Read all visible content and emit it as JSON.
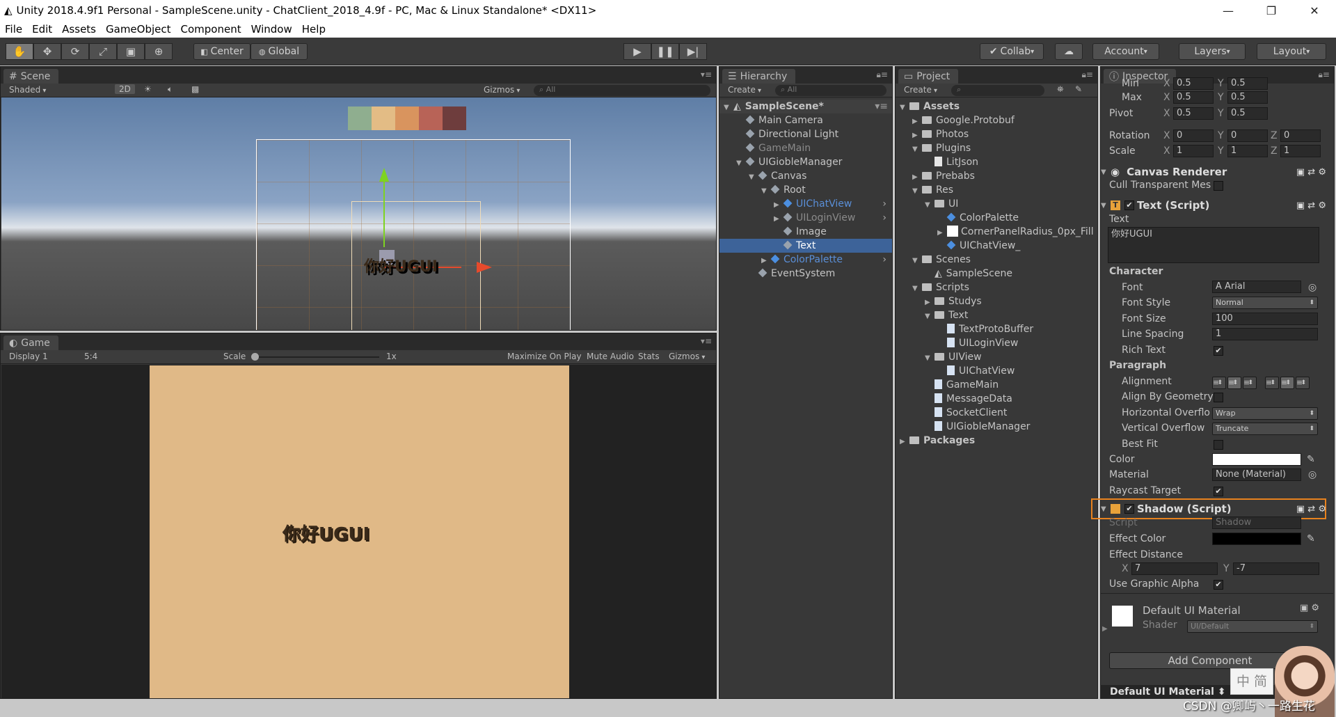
{
  "window": {
    "title": "Unity 2018.4.9f1 Personal - SampleScene.unity - ChatClient_2018_4.9f - PC, Mac & Linux Standalone* <DX11>",
    "minimize": "—",
    "restore": "❐",
    "close": "✕"
  },
  "menu": [
    "File",
    "Edit",
    "Assets",
    "GameObject",
    "Component",
    "Window",
    "Help"
  ],
  "toolbar": {
    "pivot": "Center",
    "space": "Global",
    "collab": "Collab",
    "account": "Account",
    "layers": "Layers",
    "layout": "Layout"
  },
  "scene": {
    "tab": "Scene",
    "shading": "Shaded",
    "mode2d": "2D",
    "gizmos": "Gizmos",
    "search": "All",
    "text": "你好UGUI",
    "palette": [
      "#8fae8f",
      "#e3bc85",
      "#d9945e",
      "#b86357",
      "#6e3d3d"
    ],
    "bg": "#e0b987"
  },
  "game": {
    "tab": "Game",
    "display": "Display 1",
    "aspect": "5:4",
    "scale_label": "Scale",
    "scale_value": "1x",
    "maximize": "Maximize On Play",
    "mute": "Mute Audio",
    "stats": "Stats",
    "gizmos": "Gizmos",
    "text": "你好UGUI"
  },
  "hierarchy": {
    "tab": "Hierarchy",
    "create": "Create",
    "search": "All",
    "scene": "SampleScene*",
    "items": [
      {
        "label": "Main Camera",
        "depth": 1,
        "arrow": "",
        "style": ""
      },
      {
        "label": "Directional Light",
        "depth": 1,
        "arrow": "",
        "style": ""
      },
      {
        "label": "GameMain",
        "depth": 1,
        "arrow": "",
        "style": "dim"
      },
      {
        "label": "UIGiobleManager",
        "depth": 1,
        "arrow": "▼",
        "style": ""
      },
      {
        "label": "Canvas",
        "depth": 2,
        "arrow": "▼",
        "style": ""
      },
      {
        "label": "Root",
        "depth": 3,
        "arrow": "▼",
        "style": ""
      },
      {
        "label": "UIChatView",
        "depth": 4,
        "arrow": "▶",
        "style": "blue dim",
        "more": true
      },
      {
        "label": "UILoginView",
        "depth": 4,
        "arrow": "▶",
        "style": "dim",
        "more": true
      },
      {
        "label": "Image",
        "depth": 4,
        "arrow": "",
        "style": ""
      },
      {
        "label": "Text",
        "depth": 4,
        "arrow": "",
        "style": "sel"
      },
      {
        "label": "ColorPalette",
        "depth": 3,
        "arrow": "▶",
        "style": "blue",
        "more": true
      },
      {
        "label": "EventSystem",
        "depth": 2,
        "arrow": "",
        "style": ""
      }
    ]
  },
  "project": {
    "tab": "Project",
    "create": "Create",
    "items": [
      {
        "label": "Assets",
        "depth": 0,
        "arrow": "▼",
        "icon": "folder",
        "bold": true
      },
      {
        "label": "Google.Protobuf",
        "depth": 1,
        "arrow": "▶",
        "icon": "folder"
      },
      {
        "label": "Photos",
        "depth": 1,
        "arrow": "▶",
        "icon": "folder"
      },
      {
        "label": "Plugins",
        "depth": 1,
        "arrow": "▼",
        "icon": "folder"
      },
      {
        "label": "LitJson",
        "depth": 2,
        "arrow": "",
        "icon": "file"
      },
      {
        "label": "Prebabs",
        "depth": 1,
        "arrow": "▶",
        "icon": "folder"
      },
      {
        "label": "Res",
        "depth": 1,
        "arrow": "▼",
        "icon": "folder"
      },
      {
        "label": "UI",
        "depth": 2,
        "arrow": "▼",
        "icon": "folder"
      },
      {
        "label": "ColorPalette",
        "depth": 3,
        "arrow": "",
        "icon": "prefab"
      },
      {
        "label": "CornerPanelRadius_0px_Fill",
        "depth": 3,
        "arrow": "▶",
        "icon": "white"
      },
      {
        "label": "UIChatView_",
        "depth": 3,
        "arrow": "",
        "icon": "prefab"
      },
      {
        "label": "Scenes",
        "depth": 1,
        "arrow": "▼",
        "icon": "folder"
      },
      {
        "label": "SampleScene",
        "depth": 2,
        "arrow": "",
        "icon": "unity"
      },
      {
        "label": "Scripts",
        "depth": 1,
        "arrow": "▼",
        "icon": "folder"
      },
      {
        "label": "Studys",
        "depth": 2,
        "arrow": "▶",
        "icon": "folder"
      },
      {
        "label": "Text",
        "depth": 2,
        "arrow": "▼",
        "icon": "folder"
      },
      {
        "label": "TextProtoBuffer",
        "depth": 3,
        "arrow": "",
        "icon": "cs"
      },
      {
        "label": "UILoginView",
        "depth": 3,
        "arrow": "",
        "icon": "cs"
      },
      {
        "label": "UIView",
        "depth": 2,
        "arrow": "▼",
        "icon": "folder"
      },
      {
        "label": "UIChatView",
        "depth": 3,
        "arrow": "",
        "icon": "cs"
      },
      {
        "label": "GameMain",
        "depth": 2,
        "arrow": "",
        "icon": "cs"
      },
      {
        "label": "MessageData",
        "depth": 2,
        "arrow": "",
        "icon": "cs"
      },
      {
        "label": "SocketClient",
        "depth": 2,
        "arrow": "",
        "icon": "cs"
      },
      {
        "label": "UIGiobleManager",
        "depth": 2,
        "arrow": "",
        "icon": "cs"
      },
      {
        "label": "Packages",
        "depth": 0,
        "arrow": "▶",
        "icon": "folder",
        "bold": true
      }
    ]
  },
  "inspector": {
    "tab": "Inspector",
    "min": "Min",
    "max": "Max",
    "pivot": "Pivot",
    "x": "X",
    "y": "Y",
    "z": "Z",
    "min_x": "0.5",
    "min_y": "0.5",
    "max_x": "0.5",
    "max_y": "0.5",
    "pivot_x": "0.5",
    "pivot_y": "0.5",
    "rotation": "Rotation",
    "rot_x": "0",
    "rot_y": "0",
    "rot_z": "0",
    "scale": "Scale",
    "scale_x": "1",
    "scale_y": "1",
    "scale_z": "1",
    "canvas_renderer": "Canvas Renderer",
    "cull": "Cull Transparent Mes",
    "text_script": "Text (Script)",
    "text_label": "Text",
    "text_value": "你好UGUI",
    "character": "Character",
    "font": "Font",
    "font_value": "Arial",
    "font_style": "Font Style",
    "font_style_value": "Normal",
    "font_size": "Font Size",
    "font_size_value": "100",
    "line_spacing": "Line Spacing",
    "line_spacing_value": "1",
    "rich_text": "Rich Text",
    "paragraph": "Paragraph",
    "alignment": "Alignment",
    "align_geom": "Align By Geometry",
    "h_overflow": "Horizontal Overflo",
    "h_overflow_value": "Wrap",
    "v_overflow": "Vertical Overflow",
    "v_overflow_value": "Truncate",
    "best_fit": "Best Fit",
    "color": "Color",
    "material": "Material",
    "material_value": "None (Material)",
    "raycast": "Raycast Target",
    "shadow_script": "Shadow (Script)",
    "script": "Script",
    "script_value": "Shadow",
    "effect_color": "Effect Color",
    "effect_distance": "Effect Distance",
    "ed_x": "7",
    "ed_y": "-7",
    "use_alpha": "Use Graphic Alpha",
    "default_mat": "Default UI Material",
    "shader": "Shader",
    "shader_value": "UI/Default",
    "add_component": "Add Component",
    "footer": "Default UI Material",
    "accent": "#e8821e"
  },
  "watermark": "CSDN @卿屿丶一路生花",
  "ime": "中 简"
}
